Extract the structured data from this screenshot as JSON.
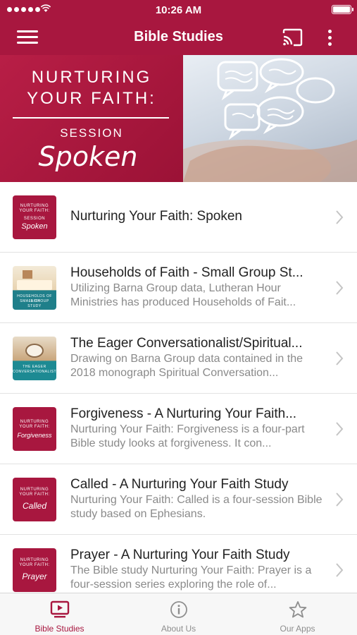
{
  "status_bar": {
    "time": "10:26 AM"
  },
  "nav": {
    "title": "Bible Studies",
    "menu_icon": "hamburger-menu-icon",
    "cast_icon": "cast-icon",
    "more_icon": "more-vertical-icon"
  },
  "banner": {
    "line1": "NURTURING",
    "line2": "YOUR FAITH:",
    "session_label": "SESSION",
    "session_name": "Spoken"
  },
  "studies": [
    {
      "title": "Nurturing Your Faith: Spoken",
      "description": "",
      "thumb_line1": "NURTURING",
      "thumb_line2": "YOUR FAITH:",
      "thumb_line3": "SESSION",
      "thumb_name": "Spoken"
    },
    {
      "title": "Households of Faith - Small Group St...",
      "description": "Utilizing Barna Group data, Lutheran Hour Ministries has produced Households of Fait...",
      "thumb_line1": "HOUSEHOLDS OF FAITH",
      "thumb_line2": "SMALL GROUP STUDY"
    },
    {
      "title": "The Eager Conversationalist/Spiritual...",
      "description": "Drawing on Barna Group data contained in the 2018 monograph Spiritual Conversation...",
      "thumb_line1": "THE EAGER CONVERSATIONALIST",
      "thumb_line2": ""
    },
    {
      "title": "Forgiveness - A Nurturing Your Faith...",
      "description": "Nurturing Your Faith: Forgiveness is a four-part Bible study looks at forgiveness. It con...",
      "thumb_line1": "NURTURING",
      "thumb_line2": "YOUR FAITH:",
      "thumb_name": "Forgiveness"
    },
    {
      "title": "Called - A Nurturing Your Faith Study",
      "description": "Nurturing Your Faith: Called is a four-session Bible study based on Ephesians.",
      "thumb_line1": "NURTURING",
      "thumb_line2": "YOUR FAITH:",
      "thumb_name": "Called"
    },
    {
      "title": "Prayer - A Nurturing Your Faith Study",
      "description": "The Bible study Nurturing Your Faith: Prayer is a four-session series exploring the role of...",
      "thumb_line1": "NURTURING",
      "thumb_line2": "YOUR FAITH:",
      "thumb_name": "Prayer"
    }
  ],
  "tabs": [
    {
      "label": "Bible Studies",
      "icon": "video-player-icon",
      "active": true
    },
    {
      "label": "About Us",
      "icon": "info-circle-icon",
      "active": false
    },
    {
      "label": "Our Apps",
      "icon": "star-outline-icon",
      "active": false
    }
  ],
  "colors": {
    "brand": "#a8173f",
    "tab_inactive": "#8e8e8e",
    "description": "#8a8a8a"
  }
}
